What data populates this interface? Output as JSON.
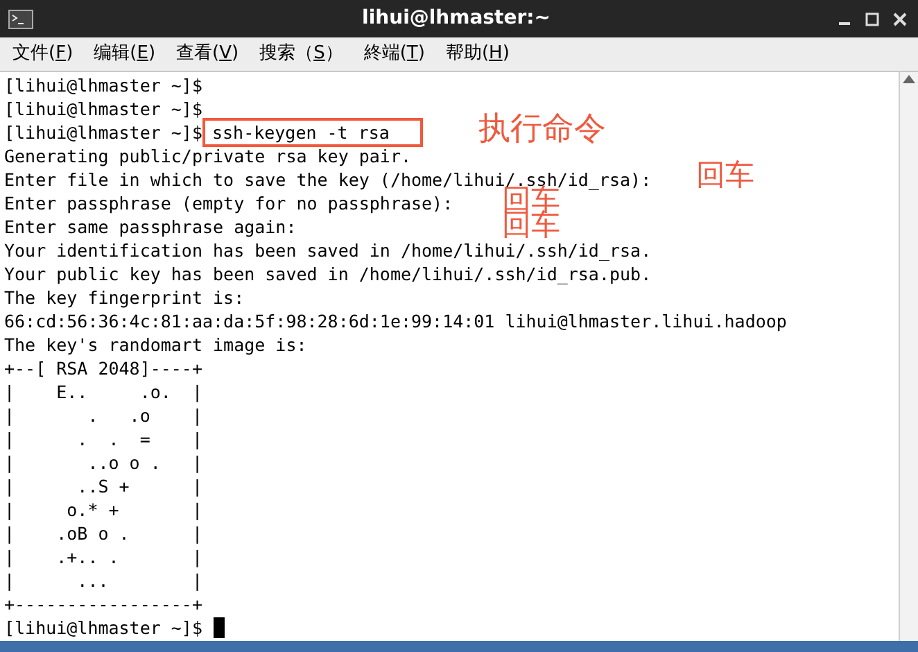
{
  "window": {
    "title": "lihui@lhmaster:~"
  },
  "menu": [
    {
      "before": "文件(",
      "key": "F",
      "after": ")"
    },
    {
      "before": "编辑(",
      "key": "E",
      "after": ")"
    },
    {
      "before": "查看(",
      "key": "V",
      "after": ")"
    },
    {
      "before": "搜索（",
      "key": "S",
      "after": "）"
    },
    {
      "before": "終端(",
      "key": "T",
      "after": ")"
    },
    {
      "before": "帮助(",
      "key": "H",
      "after": ")"
    }
  ],
  "terminal": {
    "lines": [
      {
        "kind": "prompt",
        "prompt": "[lihui@lhmaster ~]$"
      },
      {
        "kind": "prompt",
        "prompt": "[lihui@lhmaster ~]$"
      },
      {
        "kind": "prompt",
        "prompt": "[lihui@lhmaster ~]$",
        "command": "ssh-keygen -t rsa",
        "highlighted": true
      },
      {
        "kind": "output",
        "text": "Generating public/private rsa key pair."
      },
      {
        "kind": "output",
        "text": "Enter file in which to save the key (/home/lihui/.ssh/id_rsa):"
      },
      {
        "kind": "output",
        "text": "Enter passphrase (empty for no passphrase):"
      },
      {
        "kind": "output",
        "text": "Enter same passphrase again:"
      },
      {
        "kind": "output",
        "text": "Your identification has been saved in /home/lihui/.ssh/id_rsa."
      },
      {
        "kind": "output",
        "text": "Your public key has been saved in /home/lihui/.ssh/id_rsa.pub."
      },
      {
        "kind": "output",
        "text": "The key fingerprint is:"
      },
      {
        "kind": "output",
        "text": "66:cd:56:36:4c:81:aa:da:5f:98:28:6d:1e:99:14:01 lihui@lhmaster.lihui.hadoop"
      },
      {
        "kind": "output",
        "text": "The key's randomart image is:"
      },
      {
        "kind": "output",
        "text": "+--[ RSA 2048]----+"
      },
      {
        "kind": "output",
        "text": "|    E..     .o.  |"
      },
      {
        "kind": "output",
        "text": "|       .   .o    |"
      },
      {
        "kind": "output",
        "text": "|      .  .  =    |"
      },
      {
        "kind": "output",
        "text": "|       ..o o .   |"
      },
      {
        "kind": "output",
        "text": "|      ..S +      |"
      },
      {
        "kind": "output",
        "text": "|     o.* +       |"
      },
      {
        "kind": "output",
        "text": "|    .oB o .      |"
      },
      {
        "kind": "output",
        "text": "|    .+.. .       |"
      },
      {
        "kind": "output",
        "text": "|      ...        |"
      },
      {
        "kind": "output",
        "text": "+-----------------+"
      },
      {
        "kind": "prompt",
        "prompt": "[lihui@lhmaster ~]$",
        "cursor": true
      }
    ]
  },
  "annotations": [
    {
      "text": "执行命令"
    },
    {
      "text": "回车"
    },
    {
      "text": "回车"
    },
    {
      "text": "回车"
    }
  ]
}
